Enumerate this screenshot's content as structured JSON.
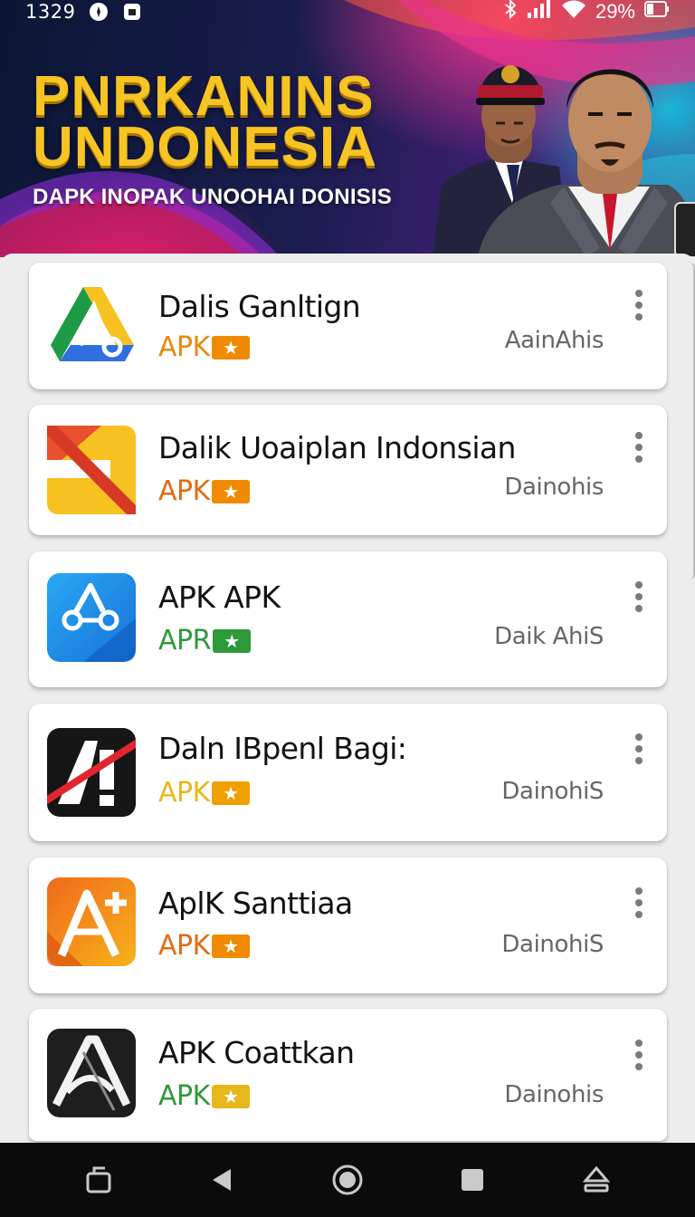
{
  "status_bar": {
    "time": "1329",
    "battery_percent": "29%",
    "icons": [
      "settings-icon",
      "notification-icon",
      "bluetooth-icon",
      "signal-icon",
      "wifi-icon",
      "battery-icon"
    ]
  },
  "banner": {
    "title_line1": "PNRKANINS",
    "title_line2": "UNDONESIA",
    "subtitle": "DAPK INOPAK UNOOHAI DONISIS"
  },
  "colors": {
    "title_yellow": "#f6c423",
    "tag_orange": "#e58a12",
    "tag_green": "#2e9a3a",
    "tag_yellow": "#e6b81c"
  },
  "apps": [
    {
      "title": "Dalis Ganltign",
      "tag": "APK",
      "tag_color": "#e58a12",
      "badge_color": "#f08a00",
      "meta": "AainAhis",
      "icon": "drive-style-icon"
    },
    {
      "title": "Dalik Uoaiplan Indonsian",
      "tag": "APK",
      "tag_color": "#e06d14",
      "badge_color": "#f08a00",
      "meta": "Dainohis",
      "icon": "slides-style-icon"
    },
    {
      "title": "APK APK",
      "tag": "APR",
      "tag_color": "#2e9a3a",
      "badge_color": "#2e9a3a",
      "meta": "Daik AhiS",
      "icon": "blue-triangle-icon"
    },
    {
      "title": "Daln IBpenl Bagi:",
      "tag": "APK",
      "tag_color": "#e6b81c",
      "badge_color": "#f0a000",
      "meta": "DainohiS",
      "icon": "black-a-icon"
    },
    {
      "title": "AplK Santtiaa",
      "tag": "APK",
      "tag_color": "#e06d14",
      "badge_color": "#f08a00",
      "meta": "DainohiS",
      "icon": "orange-a-plus-icon"
    },
    {
      "title": "APK Coattkan",
      "tag": "APK",
      "tag_color": "#2e9a3a",
      "badge_color": "#e6b81c",
      "meta": "Dainohis",
      "icon": "dark-a-icon"
    }
  ],
  "navbar": {
    "buttons": [
      "screenshot-icon",
      "back-icon",
      "home-icon",
      "recents-icon",
      "eject-icon"
    ]
  }
}
